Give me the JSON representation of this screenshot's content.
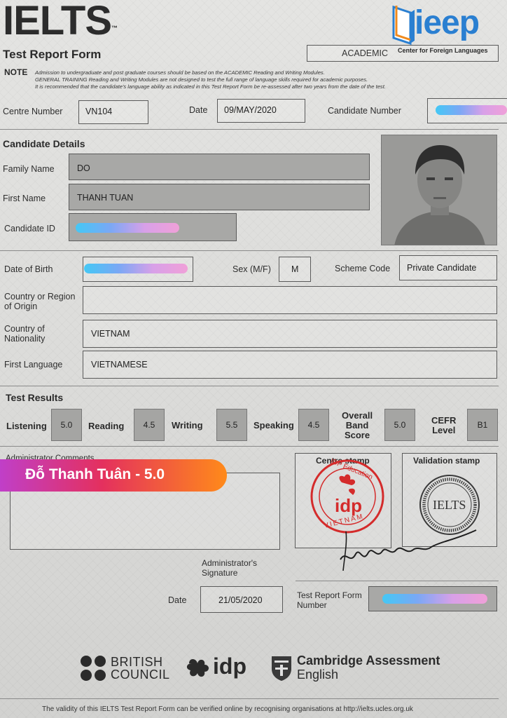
{
  "header": {
    "logo": "IELTS",
    "tm": "™",
    "subtitle": "Test Report Form",
    "module": "ACADEMIC",
    "ieep_logo": "ieep",
    "ieep_tag": "Center for Foreign Languages"
  },
  "note": {
    "label": "NOTE",
    "line1": "Admission to undergraduate and post graduate courses should be based on the ACADEMIC Reading and Writing Modules.",
    "line2": "GENERAL TRAINING Reading and Writing Modules are not designed to test the full range of language skills required for academic purposes.",
    "line3": "It is recommended that the candidate's language ability as indicated in this Test Report Form be re-assessed after two years from the date of the test."
  },
  "centre": {
    "centre_label": "Centre Number",
    "centre_value": "VN104",
    "date_label": "Date",
    "date_value": "09/MAY/2020",
    "cand_label": "Candidate Number"
  },
  "details": {
    "heading": "Candidate Details",
    "family_label": "Family Name",
    "family_value": "DO",
    "first_label": "First Name",
    "first_value": "THANH TUAN",
    "id_label": "Candidate ID",
    "dob_label": "Date of Birth",
    "sex_label": "Sex (M/F)",
    "sex_value": "M",
    "scheme_label": "Scheme Code",
    "scheme_value": "Private Candidate",
    "country_label_1": "Country or Region",
    "country_label_2": "of Origin",
    "nat_label_1": "Country of",
    "nat_label_2": "Nationality",
    "nat_value": "VIETNAM",
    "lang_label": "First Language",
    "lang_value": "VIETNAMESE"
  },
  "results": {
    "heading": "Test Results",
    "listening_label": "Listening",
    "listening": "5.0",
    "reading_label": "Reading",
    "reading": "4.5",
    "writing_label": "Writing",
    "writing": "5.5",
    "speaking_label": "Speaking",
    "speaking": "4.5",
    "overall_label_1": "Overall",
    "overall_label_2": "Band",
    "overall_label_3": "Score",
    "overall": "5.0",
    "cefr_label_1": "CEFR",
    "cefr_label_2": "Level",
    "cefr": "B1"
  },
  "bottom": {
    "admin_comments": "Administrator Comments",
    "centre_stamp": "Centre stamp",
    "validation_stamp": "Validation stamp",
    "stamp_text_top": "IDP Education",
    "stamp_idp": "idp",
    "stamp_text_bottom": "VIETNAM",
    "validation_ielts": "IELTS",
    "admin_sig_1": "Administrator's",
    "admin_sig_2": "Signature",
    "date_label": "Date",
    "date_value": "21/05/2020",
    "trf_label_1": "Test Report Form",
    "trf_label_2": "Number"
  },
  "banner": {
    "text": "Đỗ Thanh Tuân - 5.0",
    "color_start": "#c03fc8",
    "color_end": "#ff8a1a"
  },
  "footer": {
    "british_1": "BRITISH",
    "british_2": "COUNCIL",
    "idp": "idp",
    "cambridge_1": "Cambridge Assessment",
    "cambridge_2": "English",
    "validity": "The validity of this IELTS Test Report Form can be verified online by recognising organisations at http://ielts.ucles.org.uk"
  }
}
